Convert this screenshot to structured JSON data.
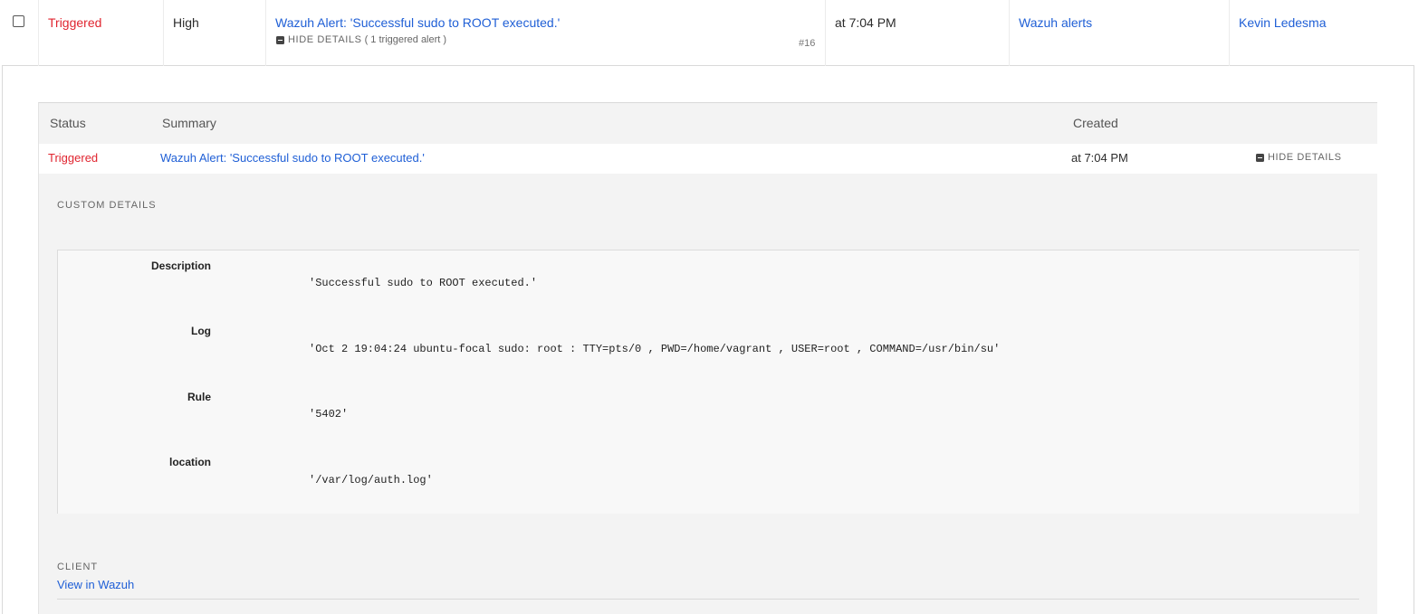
{
  "incident": {
    "status": "Triggered",
    "urgency": "High",
    "title": "Wazuh Alert: 'Successful sudo to ROOT executed.'",
    "hide_details_label": "HIDE DETAILS",
    "triggered_count": "( 1 triggered alert )",
    "number": "#16",
    "created": "at 7:04 PM",
    "service": "Wazuh alerts",
    "assignee": "Kevin Ledesma"
  },
  "alerts_table": {
    "columns": {
      "status": "Status",
      "summary": "Summary",
      "created": "Created"
    },
    "row": {
      "status": "Triggered",
      "summary": "Wazuh Alert: 'Successful sudo to ROOT executed.'",
      "created": "at 7:04 PM",
      "hide_details_label": "HIDE DETAILS"
    }
  },
  "custom_details": {
    "title": "CUSTOM DETAILS",
    "fields": [
      {
        "key": "Description",
        "value": "'Successful sudo to ROOT executed.'"
      },
      {
        "key": "Log",
        "value": "'Oct 2 19:04:24 ubuntu-focal sudo: root : TTY=pts/0 , PWD=/home/vagrant , USER=root , COMMAND=/usr/bin/su'"
      },
      {
        "key": "Rule",
        "value": "'5402'"
      },
      {
        "key": "location",
        "value": "'/var/log/auth.log'"
      }
    ]
  },
  "client": {
    "title": "CLIENT",
    "link_label": "View in Wazuh"
  },
  "colors": {
    "triggered": "#e0242f",
    "link": "#1f5fd6",
    "panel_bg": "#f3f3f3"
  }
}
